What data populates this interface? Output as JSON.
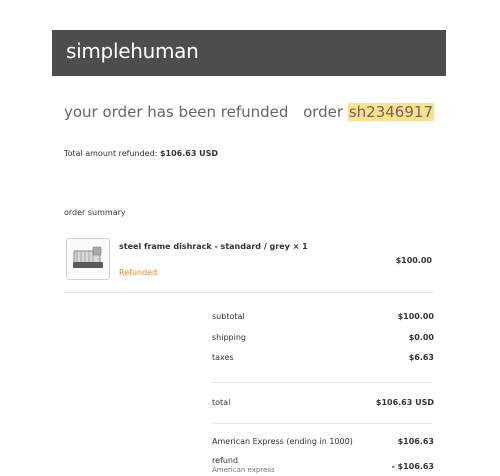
{
  "header": {
    "brand": "simplehuman"
  },
  "title": "your order has been refunded",
  "order": {
    "label": "order",
    "number": "sh2346917"
  },
  "refund_total": {
    "label": "Total amount refunded:",
    "value": "$106.63 USD"
  },
  "summary_label": "order summary",
  "item": {
    "name": "steel frame dishrack - standard / grey × 1",
    "status": "Refunded",
    "price": "$100.00",
    "image_icon": "dishrack-product-image"
  },
  "totals": {
    "subtotal": {
      "label": "subtotal",
      "value": "$100.00"
    },
    "shipping": {
      "label": "shipping",
      "value": "$0.00"
    },
    "taxes": {
      "label": "taxes",
      "value": "$6.63"
    },
    "total": {
      "label": "total",
      "value": "$106.63 USD"
    },
    "payment": {
      "label": "American Express (ending in 1000)",
      "value": "$106.63"
    },
    "refund": {
      "label": "refund",
      "sublabel": "American express",
      "value": "- $106.63"
    }
  },
  "colors": {
    "header_bg": "#4d4d4d",
    "highlight": "#ffe08a",
    "status": "#e08a2c"
  }
}
